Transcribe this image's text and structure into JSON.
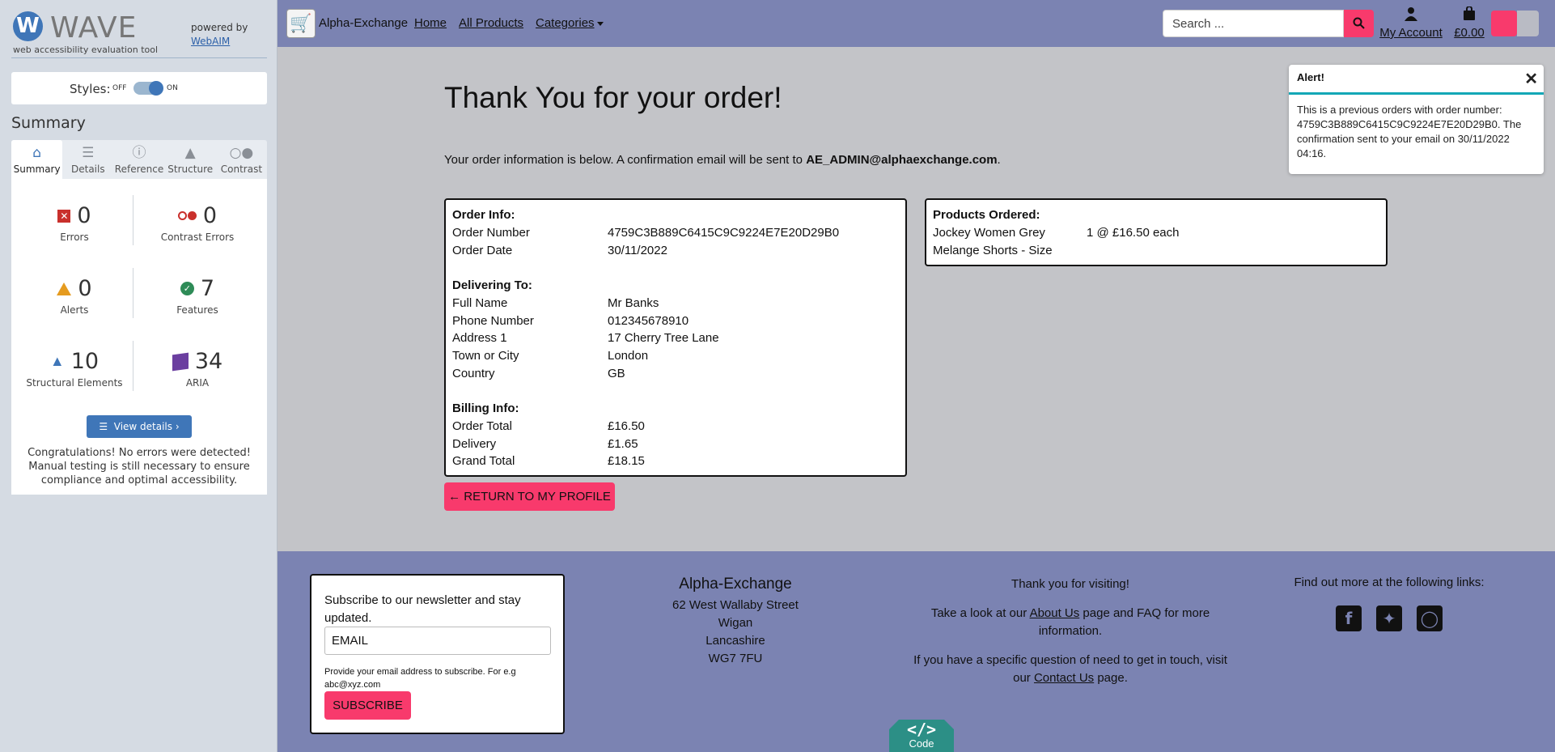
{
  "wave": {
    "logo_letter": "W",
    "logo_text": "WAVE",
    "tagline": "web accessibility evaluation tool",
    "powered_by": "powered by",
    "webaim": "WebAIM",
    "styles_label": "Styles:",
    "toggle_off": "OFF",
    "toggle_on": "ON",
    "summary_title": "Summary",
    "tabs": [
      {
        "label": "Summary",
        "icon": "home-icon"
      },
      {
        "label": "Details",
        "icon": "list-icon"
      },
      {
        "label": "Reference",
        "icon": "info-icon"
      },
      {
        "label": "Structure",
        "icon": "structure-icon"
      },
      {
        "label": "Contrast",
        "icon": "contrast-icon"
      }
    ],
    "stats": {
      "errors": {
        "value": "0",
        "label": "Errors"
      },
      "contrast_errors": {
        "value": "0",
        "label": "Contrast Errors"
      },
      "alerts": {
        "value": "0",
        "label": "Alerts"
      },
      "features": {
        "value": "7",
        "label": "Features"
      },
      "structural": {
        "value": "10",
        "label": "Structural Elements"
      },
      "aria": {
        "value": "34",
        "label": "ARIA"
      }
    },
    "view_details": "View details ›",
    "congrats": "Congratulations! No errors were detected! Manual testing is still necessary to ensure compliance and optimal accessibility."
  },
  "nav": {
    "brand": "Alpha-Exchange",
    "home": "Home",
    "all_products": "All Products",
    "categories": "Categories",
    "search_placeholder": "Search ...",
    "account": "My Account",
    "cart": "£0.00"
  },
  "main": {
    "title": "Thank You for your order!",
    "info_prefix": "Your order information is below. A confirmation email will be sent to ",
    "email": "AE_ADMIN@alphaexchange.com",
    "info_suffix": ".",
    "order_info": {
      "heading": "Order Info:",
      "rows": [
        {
          "label": "Order Number",
          "value": "4759C3B889C6415C9C9224E7E20D29B0"
        },
        {
          "label": "Order Date",
          "value": "30/11/2022"
        }
      ]
    },
    "delivering": {
      "heading": "Delivering To:",
      "rows": [
        {
          "label": "Full Name",
          "value": "Mr Banks"
        },
        {
          "label": "Phone Number",
          "value": "012345678910"
        },
        {
          "label": "Address 1",
          "value": "17 Cherry Tree Lane"
        },
        {
          "label": "Town or City",
          "value": "London"
        },
        {
          "label": "Country",
          "value": "GB"
        }
      ]
    },
    "billing": {
      "heading": "Billing Info:",
      "rows": [
        {
          "label": "Order Total",
          "value": "£16.50"
        },
        {
          "label": "Delivery",
          "value": "£1.65"
        },
        {
          "label": "Grand Total",
          "value": "£18.15"
        }
      ]
    },
    "products": {
      "heading": "Products Ordered:",
      "item_line1": "Jockey Women Grey",
      "item_line2": "Melange Shorts - Size",
      "qty": "1 @ £16.50 each"
    },
    "return_button": "← RETURN TO MY PROFILE"
  },
  "alert": {
    "title": "Alert!",
    "body": "This is a previous orders with order number: 4759C3B889C6415C9C9224E7E20D29B0. The confirmation sent to your email on 30/11/2022 04:16."
  },
  "footer": {
    "newsletter": "Subscribe to our newsletter and stay updated.",
    "email_placeholder": "EMAIL",
    "hint": "Provide your email address to subscribe. For e.g abc@xyz.com",
    "subscribe": "SUBSCRIBE",
    "company": "Alpha-Exchange",
    "address": [
      "62 West Wallaby Street",
      "Wigan",
      "Lancashire",
      "WG7 7FU"
    ],
    "thanks": "Thank you for visiting!",
    "about_pre": "Take a look at our ",
    "about_link": "About Us",
    "about_post": " page and FAQ for more information.",
    "contact_pre": "If you have a specific question of need to get in touch, visit our ",
    "contact_link": "Contact Us",
    "contact_post": " page.",
    "links_title": "Find out more at the following links:",
    "socials": [
      "facebook-icon",
      "twitter-icon",
      "instagram-icon"
    ],
    "code_glyph": "</>",
    "code_label": "Code"
  },
  "colors": {
    "nav_bg": "#7b83b2",
    "accent_pink": "#f83a6c",
    "wave_blue": "#3f76b8",
    "alert_teal": "#13a7b6"
  }
}
